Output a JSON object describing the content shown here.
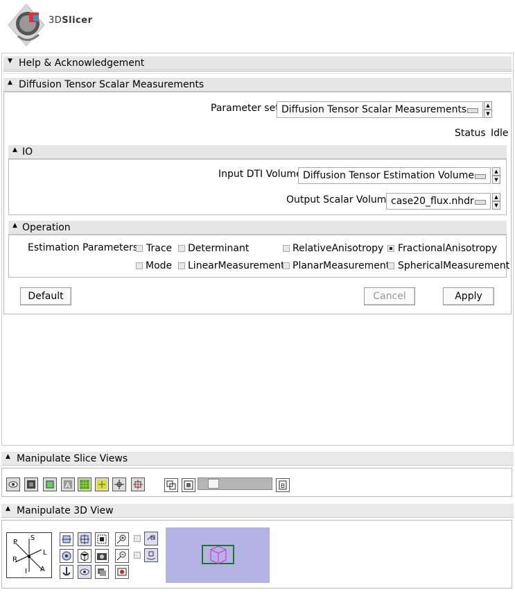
{
  "app": {
    "logo_text_3d": "3D",
    "logo_text_slicer": "Slicer"
  },
  "help_section": {
    "title": "Help & Acknowledgement"
  },
  "module": {
    "title": "Diffusion Tensor Scalar Measurements",
    "parameter_set_label": "Parameter set",
    "parameter_set_value": "Diffusion Tensor Scalar Measurements",
    "status_label": "Status",
    "status_value": "Idle",
    "io": {
      "title": "IO",
      "input_label": "Input DTI Volume",
      "input_value": "Diffusion Tensor Estimation Volume",
      "output_label": "Output Scalar Volume",
      "output_value": "case20_flux.nhdr"
    },
    "operation": {
      "title": "Operation",
      "estimation_label": "Estimation Parameters",
      "options": [
        {
          "label": "Trace",
          "checked": false
        },
        {
          "label": "Determinant",
          "checked": false
        },
        {
          "label": "RelativeAnisotropy",
          "checked": false
        },
        {
          "label": "FractionalAnisotropy",
          "checked": true
        },
        {
          "label": "Mode",
          "checked": false
        },
        {
          "label": "LinearMeasurement",
          "checked": false
        },
        {
          "label": "PlanarMeasurement",
          "checked": false
        },
        {
          "label": "SphericalMeasurement",
          "checked": false
        }
      ]
    },
    "buttons": {
      "default": "Default",
      "cancel": "Cancel",
      "apply": "Apply"
    }
  },
  "slice_views": {
    "title": "Manipulate Slice Views",
    "slider_fraction": 0.15
  },
  "view_3d": {
    "title": "Manipulate 3D View",
    "orientation_letters": {
      "p": "P",
      "s": "S",
      "r": "R",
      "l": "L",
      "i": "I",
      "a": "A"
    }
  },
  "colors": {
    "header_bg": "#e6e6e6",
    "thumbnail_bg": "#b3b3e6",
    "box_green": "#1a7a1a",
    "box_magenta": "#e020e0"
  }
}
